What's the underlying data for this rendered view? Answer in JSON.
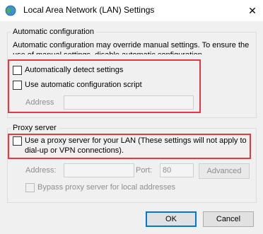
{
  "window": {
    "title": "Local Area Network (LAN) Settings",
    "close_glyph": "✕",
    "icon": "network-globe-icon"
  },
  "auto_config": {
    "legend": "Automatic configuration",
    "description": "Automatic configuration may override manual settings.  To ensure the use of manual settings, disable automatic configuration.",
    "detect_label": "Automatically detect settings",
    "detect_checked": false,
    "script_label": "Use automatic configuration script",
    "script_checked": false,
    "address_label": "Address",
    "address_value": ""
  },
  "proxy": {
    "legend": "Proxy server",
    "use_proxy_label": "Use a proxy server for your LAN (These settings will not apply to dial-up or VPN connections).",
    "use_proxy_checked": false,
    "address_label": "Address:",
    "address_value": "",
    "port_label": "Port:",
    "port_value": "80",
    "advanced_label": "Advanced",
    "bypass_label": "Bypass proxy server for local addresses",
    "bypass_checked": false
  },
  "buttons": {
    "ok_label": "OK",
    "cancel_label": "Cancel"
  },
  "colors": {
    "highlight": "#e8383d",
    "primary_button_border": "#0078d7"
  }
}
